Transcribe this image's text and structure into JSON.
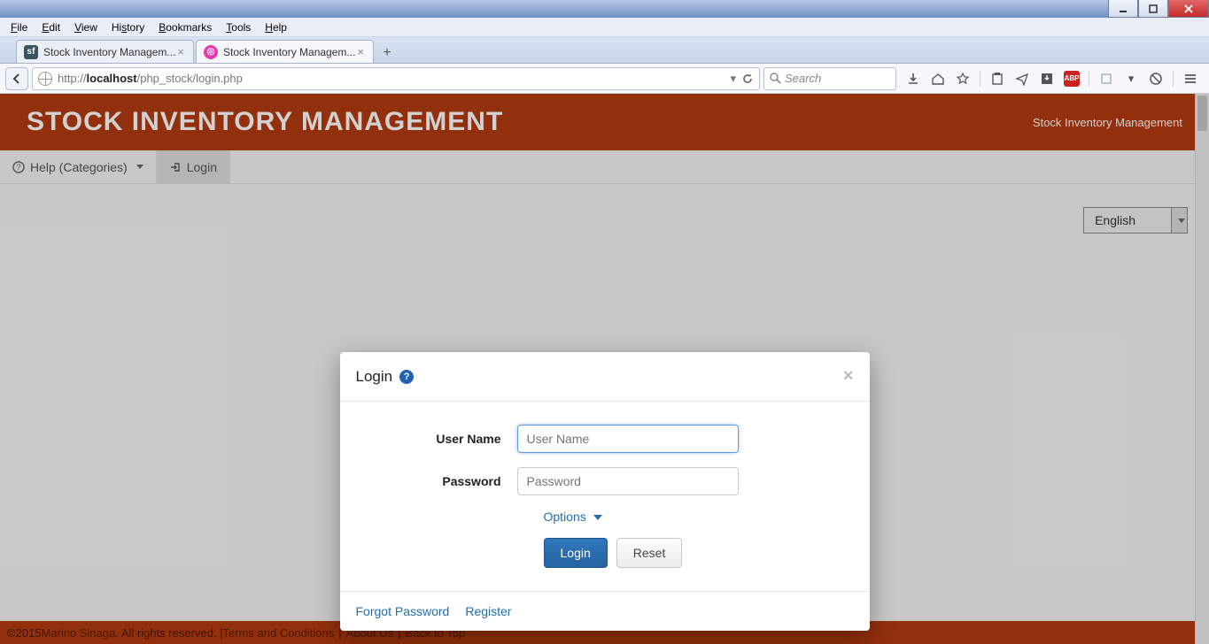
{
  "os_menu": [
    "File",
    "Edit",
    "View",
    "History",
    "Bookmarks",
    "Tools",
    "Help"
  ],
  "tabs": [
    {
      "label": "Stock Inventory Managem...",
      "active": false
    },
    {
      "label": "Stock Inventory Managem...",
      "active": true
    }
  ],
  "url_prefix": "http://",
  "url_host": "localhost",
  "url_path": "/php_stock/login.php",
  "search_placeholder": "Search",
  "app": {
    "title": "STOCK INVENTORY MANAGEMENT",
    "subtitle": "Stock Inventory Management",
    "nav_help": "Help (Categories)",
    "nav_login": "Login",
    "language": "English"
  },
  "modal": {
    "title": "Login",
    "username_label": "User Name",
    "username_placeholder": "User Name",
    "password_label": "Password",
    "password_placeholder": "Password",
    "options": "Options",
    "login_btn": "Login",
    "reset_btn": "Reset",
    "forgot": "Forgot Password",
    "register": "Register"
  },
  "footer": {
    "copyright": "©2015 ",
    "author": "Marino Sinaga",
    "rights": ". All rights reserved. | ",
    "terms": "Terms and Conditions",
    "about": "About Us",
    "back": "Back to Top"
  }
}
